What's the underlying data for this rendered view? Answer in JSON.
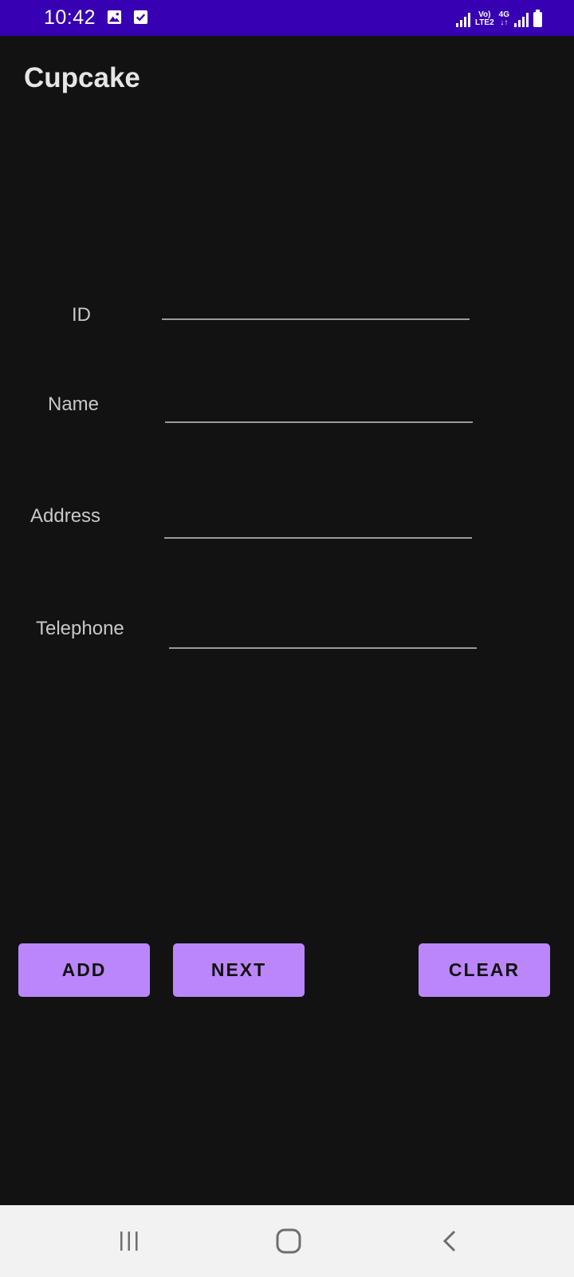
{
  "status_bar": {
    "time": "10:42",
    "network_top": "Vo)",
    "network_bottom": "LTE2",
    "network_4g": "4G",
    "icons": [
      "image-icon",
      "check-box-icon",
      "signal-icon",
      "battery-icon"
    ]
  },
  "app_bar": {
    "title": "Cupcake"
  },
  "form": {
    "fields": [
      {
        "label": "ID",
        "value": "",
        "placeholder": ""
      },
      {
        "label": "Name",
        "value": "",
        "placeholder": ""
      },
      {
        "label": "Address",
        "value": "",
        "placeholder": ""
      },
      {
        "label": "Telephone",
        "value": "",
        "placeholder": ""
      }
    ]
  },
  "buttons": {
    "add": "ADD",
    "next": "NEXT",
    "clear": "CLEAR"
  },
  "nav_bar": {
    "icons": [
      "recent-apps-icon",
      "home-icon",
      "back-icon"
    ]
  },
  "colors": {
    "status_bar": "#3700b3",
    "background": "#121212",
    "button": "#bb86fc",
    "nav_bar": "#f2f2f2"
  }
}
